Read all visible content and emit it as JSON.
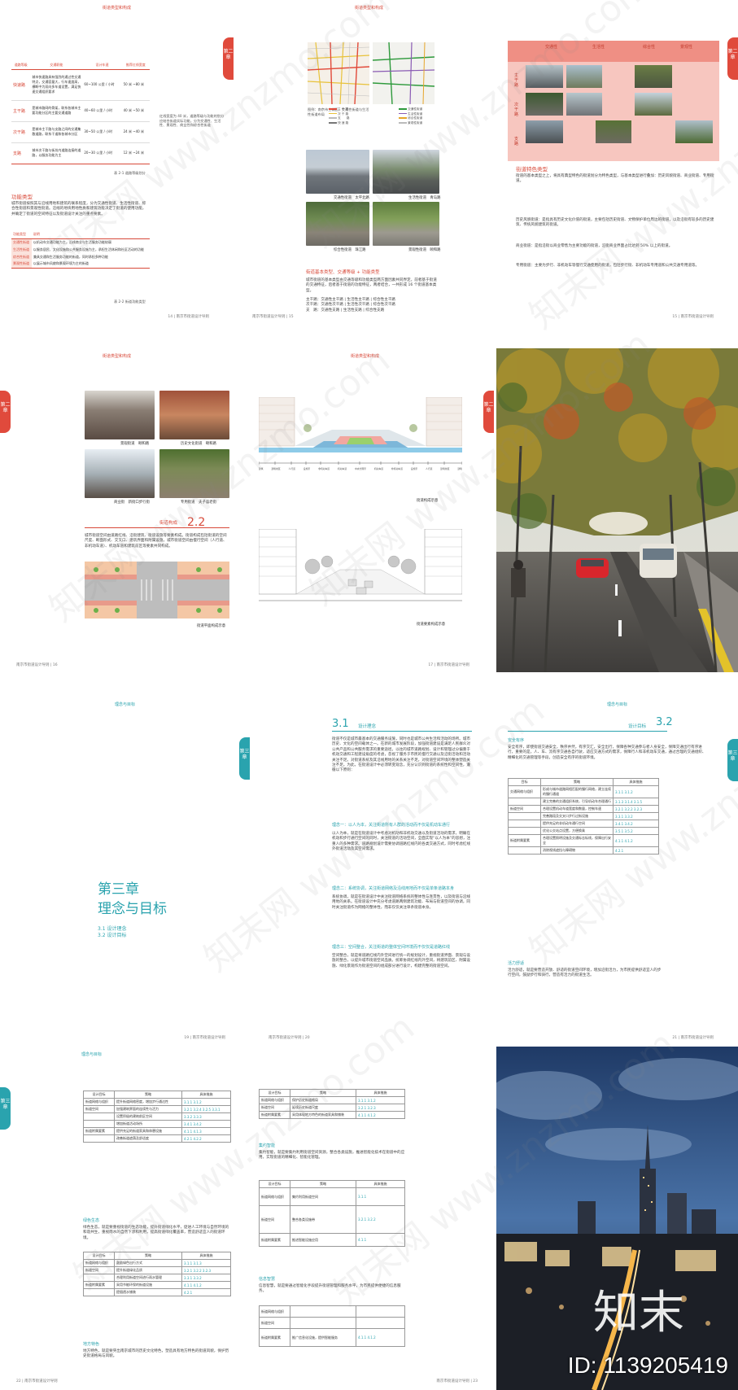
{
  "page_title": "南京市街道设计导则",
  "colors": {
    "red": "#d84a3a",
    "teal": "#2aa3ae"
  },
  "row1": {
    "p1": {
      "header": "街道类型和构成",
      "tab": "第二章",
      "table1_headers": [
        "道路等级",
        "交通职能",
        "设计车速",
        "推荐红线宽度"
      ],
      "table1_rows": [
        [
          "快速路",
          "城市快速路具有强烈的通过性交通特点，交通容量大，行车速度高，横断中为双向多车道设置，满足快速交通组织要求",
          "60~100 公里 / 小时",
          "50 米 ~80 米"
        ],
        [
          "主干路",
          "是城市路网的骨架，联系各城市主要功能分区的主要交通道路",
          "40~60 公里 / 小时",
          "40 米 ~50 米"
        ],
        [
          "次干路",
          "是城市主干路与支路之间的交通集散道路，联系干道和各城市分区",
          "30~50 公里 / 小时",
          "24 米 ~40 米"
        ],
        [
          "支路",
          "城市次干路与街坊内道路连接的道路，以服务功能为主",
          "20~30 公里 / 小时",
          "12 米 ~24 米"
        ]
      ],
      "table1_caption": "表 2-1 道路等级划分",
      "side_note": "红线宽度为 40 米，道路等级与功能的划分应结合街道实际功能，分为交通性、生活性、景观性、商业性和综合性街道",
      "section": "功能类型",
      "para": "城市街道按照其与沿线用地和建筑的联系程度，分为交通性街道、生活性街道、综合性街道和景观性街道。沿线的地块用地性质和建筑功能决定了街道的使用功能，并确定了街道的空间特征以及街道设计关注的重点要素。",
      "table2_headers": [
        "功能类型",
        "说明"
      ],
      "table2_rows": [
        [
          "交通性街道",
          "以机动车交通功能为主，沿线商业与生活服务功能较弱"
        ],
        [
          "生活性街道",
          "以服务居民、文化设施和公共服务设施为主，承担生活休闲和社区活动的功能"
        ],
        [
          "综合性街道",
          "兼具交通和生活服务功能的街道，同时承担多种功能"
        ],
        [
          "景观性街道",
          "以展示城市风貌和景观环境为主的街道"
        ]
      ],
      "table2_caption": "表 2-2 街道功能类型",
      "footer": "14 | 南京市街道设计导则"
    },
    "p2": {
      "header": "街道类型和构成",
      "map_caption": "图例：南京市主城区，交通性街道与生活性街道布局",
      "legend_left": [
        "主 干 路",
        "次 干 路",
        "支　　路",
        "快 速 路"
      ],
      "legend_right": [
        "交通性街道",
        "生活性街道",
        "综合性街道",
        "景观性街道"
      ],
      "photo_captions": [
        "交通性街道　太平北路",
        "生活性街道　青岛路",
        "综合性街道　珠江路",
        "景观性街道　颐和路"
      ],
      "section": "街道基本类型、交通等级 + 功能类型",
      "para": "城市街道的基本类型由交通等级和功能类型两方面因素共同界定。前者基于街道的交通特征，后者基于街道的功能特征，两者结合，一共形成 16 个街道基本类型。",
      "list": [
        "主干路：交通性主干路 | 生活性主干路 | 综合性主干路",
        "次干路：交通性次干路 | 生活性次干路 | 综合性次干路",
        "支　路：交通性支路 | 生活性支路 | 综合性支路"
      ],
      "footer": "南京市街道设计导则 | 15"
    },
    "p3": {
      "tab": "第二章",
      "pink_headers": [
        "交通性",
        "生活性",
        "综合性",
        "景观性"
      ],
      "row_labels": [
        "主干路",
        "次干路",
        "支路"
      ],
      "section": "街道特色类型",
      "paras": [
        "街道的基本类型之上，将具有典型特色的街道划分为特色类型，与基本类型进行叠加：历史风貌街道、商业街道、专用街道。",
        "历史风貌街道：是指具有历史文化价值的街道，主要包括历史街道、文物保护单位周边的街道，以及沿街有较多的历史建筑、传统风貌建筑的街道。",
        "商业街道：是指沿街以商业零售为主要功能的街道，沿街商业界面占比达到 50% 以上的街道。",
        "专用街道：主要为步行、非机动车等慢行交通使用的街道，包括步行街、非机动车专用道和公共交通专用道等。"
      ],
      "footer": "15 | 南京市街道设计导则"
    }
  },
  "row2": {
    "p1": {
      "header": "街道类型和构成",
      "tab": "第二章",
      "photo_captions": [
        "景观街道　颐和路",
        "历史文化街道　颐和路",
        "商业街　新街口步行街",
        "专用街道　夫子庙老街"
      ],
      "section_num": "2.2",
      "section": "街道构成",
      "para": "城市街道空间由道路红线、沿街建筑、街道设施等要素构成。街道构成包括街道的空间尺度、断面形式、交叉口、建筑界面和附属设施，城市街道空间由慢行空间（人行道、非机动车道）、机动车道和建筑前区等要素共同构成。",
      "plan_caption": "街道平面构成示意",
      "footer": "南京市街道设计导则 | 16"
    },
    "p2": {
      "header": "街道类型和构成",
      "tab": "第二章",
      "axis_labels": [
        "建筑",
        "建筑前区",
        "人行道",
        "设施带",
        "非机动车道",
        "机动车道",
        "中央分隔带",
        "机动车道",
        "非机动车道",
        "设施带",
        "人行道",
        "建筑前区",
        "建筑"
      ],
      "caption1": "街道构成示意",
      "caption2": "街道要素构成示意",
      "footer": "17 | 南京市街道设计导则"
    }
  },
  "row3": {
    "p1": {
      "header": "理念与目标",
      "tab": "第三章",
      "chapter": "第三章",
      "chapter_title": "理念与目标",
      "toc": [
        "3.1 设计理念",
        "3.2 设计目标"
      ],
      "footer": "19 | 南京市街道设计导则"
    },
    "p2": {
      "section_num": "3.1",
      "section": "设计理念",
      "intro": "街道不仅是城市最基本的交通服务设施，同时也是城市公共生活和活动的场所。城市历史、文化的空间载体之一。在新的城市发展阶段，加强街道建设是满足人民群众对公共产品和公共服务需求的重要途径。以往的城市道路规划、设计和管理过分偏重于机动交通和工程建设角度的考虑，忽视了服务于市民的慢行交通以及沿街活动和活动关注不足。对街道系统及其沿线用地的关系关注不足。对街道空间环境的整体塑造关注不足。为此，在街道设计中必须转变观念，充分认识到街道的系统性和空间性，遵循以下原则：",
      "items": [
        {
          "title": "理念一：以人为本，关注街道所有人群的活动而不仅是机动车通行",
          "text": "以人为本，就是在街道设计中考虑对机动和非机动交通以及街道活动的需求，明确在机动和步行通行空间的同时，关注街道的活动空间，全面实现“以人为本”的思想，注重人的多种需求。道路规划设计需要协调道路红线内的各类交通方式，同时考虑红线外街道活动及其空间需求。"
        },
        {
          "title": "理念二：系统协调，关注街道网络及沿线用地而不仅是单条道路本身",
          "text": "系统协调，就是在街道设计中关注街道网络系统的整体性与连贯性，以及街道与沿线用地的关系。在街道设计中充分考虑道路两侧建筑功能、布局与街道空间的协调，同时关注街道作为网络的整体性，而非仅仅关注单条街道本身。"
        },
        {
          "title": "理念三：空间整合，关注街道的整体空间环境而不仅仅是道路红线",
          "text": "空间整合，就是将道路红线内外空间进行统一的规划设计，重视街道界面、景观与设施的整合，以提升城市街道空间品质。统筹协调红线内外空间，将建筑前区、附属设施、绿化景观作为街道空间的组成部分进行设计，构建完整的街道空间。"
        }
      ],
      "footer": "南京市街道设计导则 | 20"
    },
    "p3": {
      "header": "理念与目标",
      "tab": "第三章",
      "section_num": "3.2",
      "section": "设计目标",
      "sub1": "安全有序",
      "para1": "安全有序，即使街道交通安全，秩序井然，有序交汇，安全出行，保障各种交通参与者人身安全，保障交通出行有序进行，重要的是，人、车、流有序交通各自行驶，适应交通方式的需求，保障行人和非机动车交通，通过合理的交通组织、精细化的交通管理等手段，创造安全有序的街道环境。",
      "table_headers": [
        "目标",
        "策略",
        "具体措施"
      ],
      "table_rows": [
        [
          "交通网络与组织",
          "形成与城市道路网相匹配的慢行网络，建立连续的慢行通道",
          "3.1.1  3.1.2"
        ],
        [
          "",
          "建立完善的交通组织系统，引导机动车合理通行",
          "3.1.3  3.1.4  3.1.5"
        ],
        [
          "街道空间",
          "合理设置机动车道宽度和数量，控制车速",
          "3.2.1  3.2.2  3.2.3"
        ],
        [
          "",
          "完善路段及交叉口步行过街设施",
          "3.3.1  3.3.2"
        ],
        [
          "",
          "提供充足的非机动车通行空间",
          "3.4.1  3.4.2"
        ],
        [
          "",
          "优化公交站点设置，方便换乘",
          "3.5.1  3.5.2"
        ],
        [
          "街道附属要素",
          "合理设置照明设施及交通标志标线，保障出行安全",
          "4.1.1  4.1.2"
        ],
        [
          "",
          "消除视线遮挡与障碍物",
          "4.2.1"
        ]
      ],
      "sub2": "活力舒适",
      "para2": "活力舒适，就是要营造开放、舒适的街道空间环境，增加沿街活力，为市民提供舒适宜人的步行空间，鼓励步行和骑行，营造有活力的街道生活。",
      "footer": "21 | 南京市街道设计导则"
    }
  },
  "row4": {
    "p1": {
      "header": "理念与目标",
      "tab": "第三章",
      "table_headers": [
        "设计目标",
        "策略",
        "具体措施"
      ],
      "table_rows": [
        [
          "街道网络与组织",
          "提升街道网络密度，增加步行通达性",
          "3.1.1  3.1.2"
        ],
        [
          "街道空间",
          "加强建筑界面的连续性与活力",
          "3.2.1  3.2.4  3.2.5  3.3.1"
        ],
        [
          "",
          "设置积极的建筑前区空间",
          "3.3.2  3.3.3"
        ],
        [
          "",
          "增加街道活动场所",
          "3.4.1  3.4.2"
        ],
        [
          "街道附属要素",
          "提供充足的街道家具和休憩设施",
          "4.1.1  4.1.3"
        ],
        [
          "",
          "改善街道遮荫及舒适度",
          "4.2.1  4.2.2"
        ]
      ],
      "sub1": "绿色生态",
      "para1": "绿色生态，就是要重视街道的生态功能，提升街道绿化水平，促进人工环境与自然环境的和谐共生，重视雨水的自然下渗和利用，提高街道绿化覆盖率，营造舒适宜人的街道环境。",
      "table2_headers": [
        "设计目标",
        "策略",
        "具体措施"
      ],
      "table2_rows": [
        [
          "街道网络与组织",
          "鼓励绿色出行方式",
          "3.1.1  3.1.3"
        ],
        [
          "街道空间",
          "提升街道绿化品质",
          "3.2.1  3.2.2  3.2.3"
        ],
        [
          "",
          "合理利用街道空间进行雨水管理",
          "3.3.1  3.3.2"
        ],
        [
          "街道附属要素",
          "采用节能环保的街道设施",
          "4.1.1  4.1.2"
        ],
        [
          "",
          "提倡透水铺装",
          "4.2.1"
        ]
      ],
      "sub2": "地方特色",
      "para2": "地方特色，就是要突出南京城市的历史文化特色，塑造具有地方特色的街道风貌，保护历史街道格局与风貌。",
      "footer": "22 | 南京市街道设计导则"
    },
    "p2": {
      "table_headers": [
        "设计目标",
        "策略",
        "具体措施"
      ],
      "table_rows": [
        [
          "街道网络与组织",
          "保护历史街道格局",
          "3.1.1  3.1.2"
        ],
        [
          "街道空间",
          "延续历史街道尺度",
          "3.2.1  3.2.3"
        ],
        [
          "街道附属要素",
          "采用体现地方特色的街道家具和铺装",
          "4.1.1  4.1.2"
        ]
      ],
      "sub1": "集约智能",
      "para1": "集约智能，就是要集约利用街道空间资源，整合各类设施，推进智能化技术在街道中的应用，实现街道的精细化、智能化管理。",
      "table2_headers": [
        "设计目标",
        "策略",
        "具体措施"
      ],
      "table2_rows": [
        [
          "街道网络与组织",
          "集约利用街道空间",
          "3.1.1"
        ],
        [
          "街道空间",
          "整合各类设施带",
          "3.2.1  3.2.2"
        ],
        [
          "街道附属要素",
          "推进智能设施应用",
          "4.1.1"
        ]
      ],
      "sub2": "信息智慧",
      "para2": "信息智慧，就是要通过智能化手段提升街道管理和服务水平，为市民提供便捷的信息服务。",
      "table3_rows": [
        [
          "街道网络与组织",
          "",
          ""
        ],
        [
          "街道空间",
          "",
          ""
        ],
        [
          "街道附属要素",
          "推广信息化设施，提供智能服务",
          "4.1.1  4.1.2"
        ]
      ],
      "footer": "南京市街道设计导则 | 23"
    },
    "p3": {
      "logo": "知末",
      "id_text": "ID: 1139205419"
    }
  },
  "watermark": "知末网 www.znzmo.com"
}
